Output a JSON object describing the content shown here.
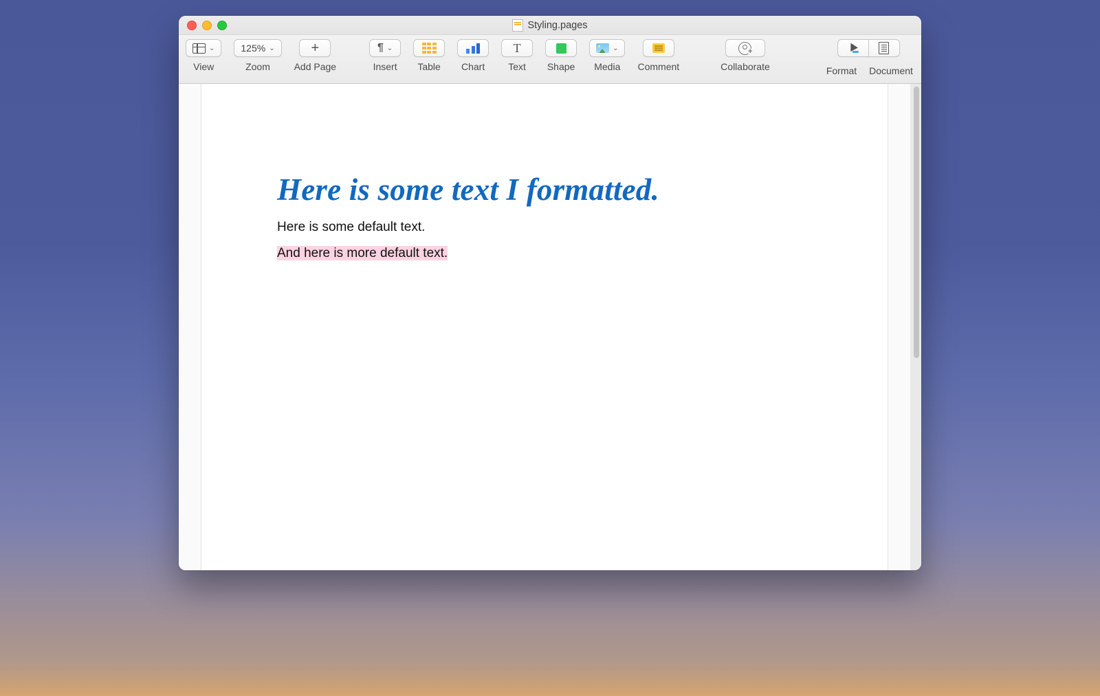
{
  "window": {
    "title": "Styling.pages"
  },
  "toolbar": {
    "view": {
      "label": "View"
    },
    "zoom": {
      "label": "Zoom",
      "value": "125%"
    },
    "addpage": {
      "label": "Add Page"
    },
    "insert": {
      "label": "Insert"
    },
    "table": {
      "label": "Table"
    },
    "chart": {
      "label": "Chart"
    },
    "text": {
      "label": "Text"
    },
    "shape": {
      "label": "Shape"
    },
    "media": {
      "label": "Media"
    },
    "comment": {
      "label": "Comment"
    },
    "collaborate": {
      "label": "Collaborate"
    },
    "format": {
      "label": "Format"
    },
    "document": {
      "label": "Document"
    }
  },
  "document": {
    "lines": {
      "formatted": "Here is some text I formatted.",
      "default": "Here is some default text.",
      "selected": "And here is more default text."
    }
  }
}
